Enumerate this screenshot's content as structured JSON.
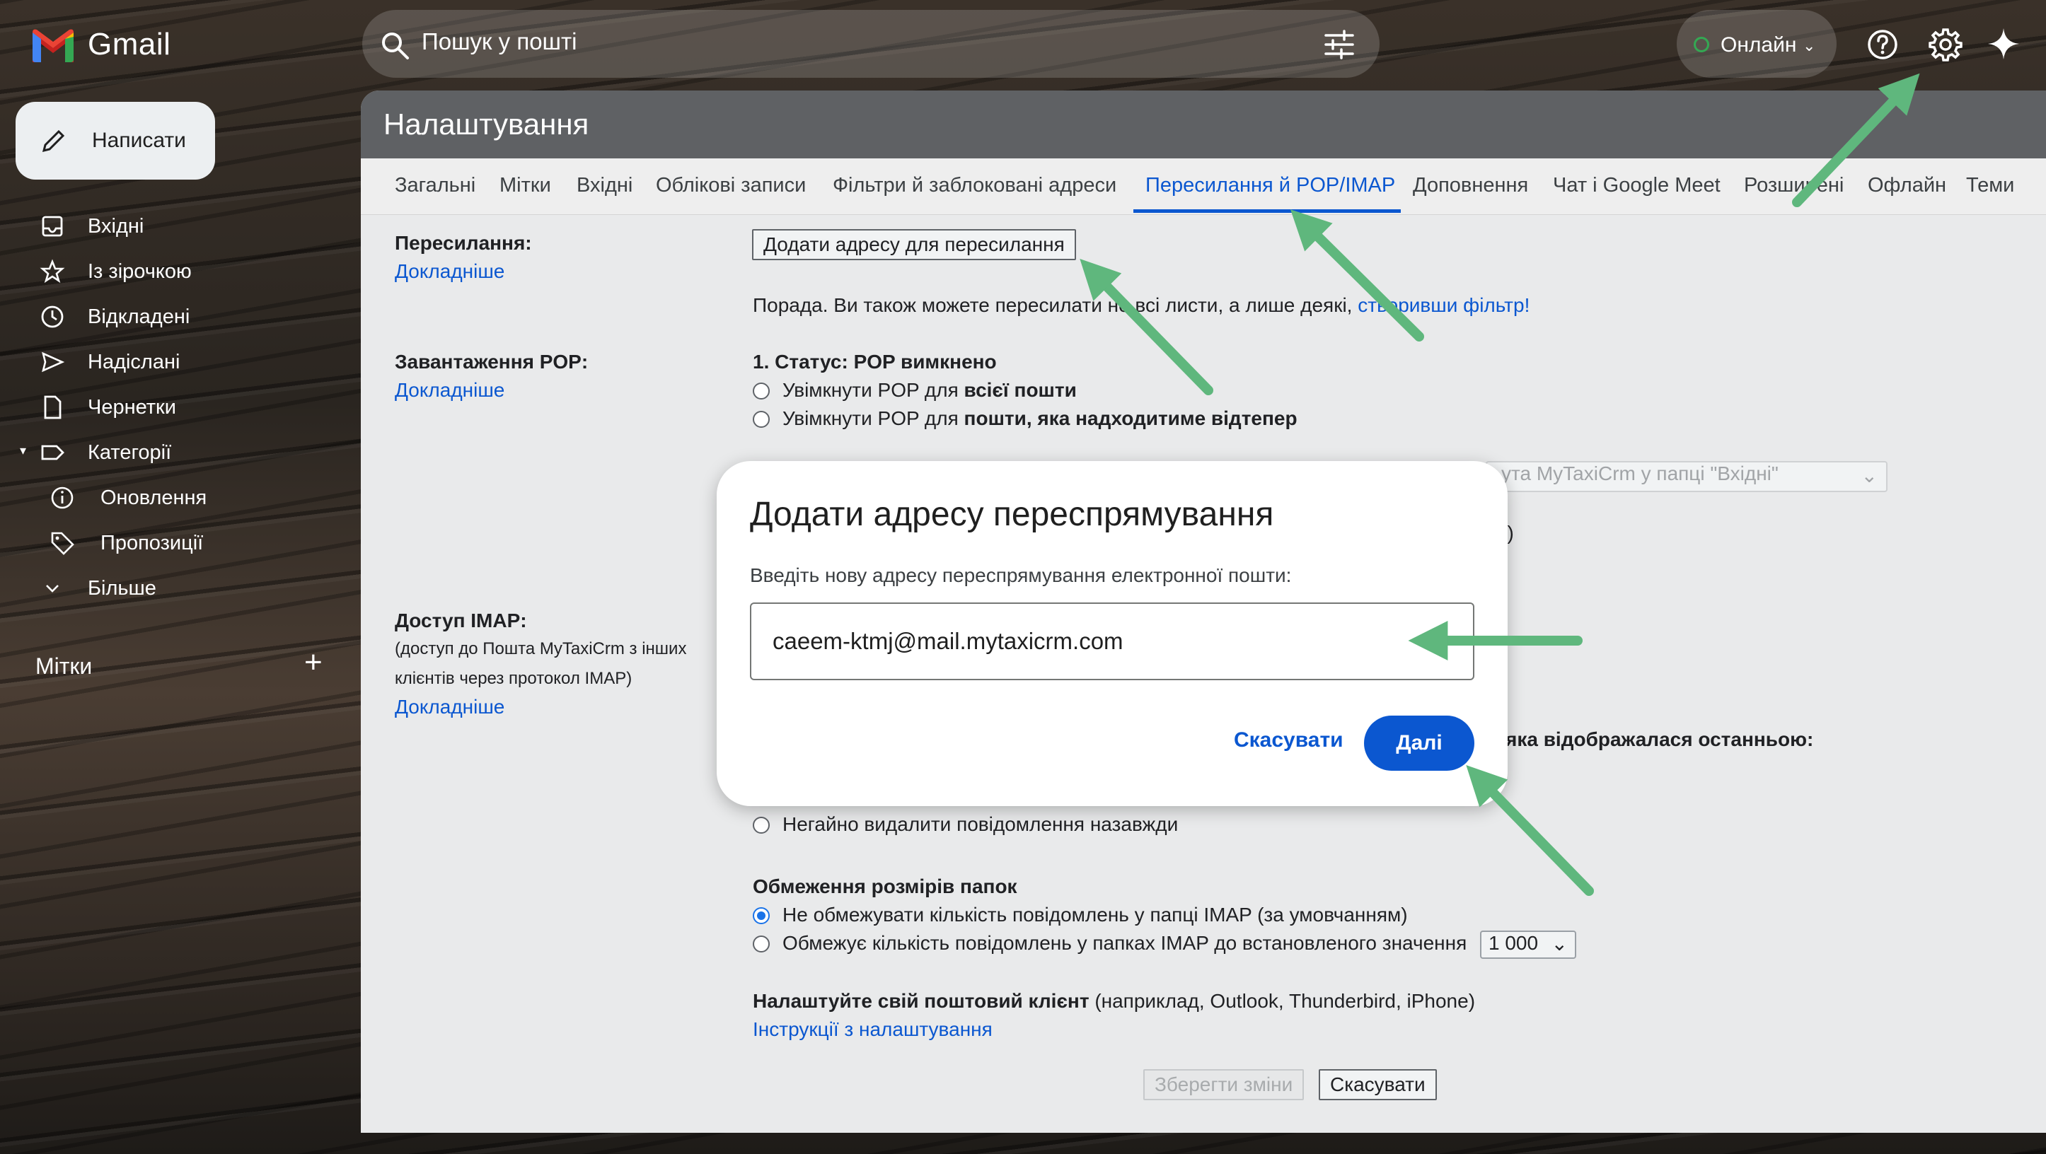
{
  "app": {
    "logo_text": "Gmail"
  },
  "search": {
    "placeholder": "Пошук у пошті"
  },
  "status": {
    "label": "Онлайн"
  },
  "compose": {
    "label": "Написати"
  },
  "sidebar": {
    "items": [
      {
        "label": "Вхідні"
      },
      {
        "label": "Із зірочкою"
      },
      {
        "label": "Відкладені"
      },
      {
        "label": "Надіслані"
      },
      {
        "label": "Чернетки"
      },
      {
        "label": "Категорії"
      },
      {
        "label": "Оновлення"
      },
      {
        "label": "Пропозиції"
      },
      {
        "label": "Більше"
      }
    ],
    "labels_heading": "Мітки",
    "labels_add": "+"
  },
  "settings": {
    "title": "Налаштування",
    "tabs": [
      {
        "label": "Загальні"
      },
      {
        "label": "Мітки"
      },
      {
        "label": "Вхідні"
      },
      {
        "label": "Облікові записи"
      },
      {
        "label": "Фільтри й заблоковані адреси"
      },
      {
        "label": "Пересилання й POP/IMAP",
        "active": true
      },
      {
        "label": "Доповнення"
      },
      {
        "label": "Чат і Google Meet"
      },
      {
        "label": "Розширені"
      },
      {
        "label": "Офлайн"
      },
      {
        "label": "Теми"
      }
    ],
    "forwarding": {
      "label": "Пересилання:",
      "learn_more": "Докладніше",
      "add_button": "Додати адресу для пересилання",
      "tip_prefix": "Порада. Ви також можете пересилати не всі листи, а лише деякі,",
      "tip_link": "створивши фільтр!"
    },
    "pop": {
      "label": "Завантаження POP:",
      "learn_more": "Докладніше",
      "status": "1. Статус: POP вимкнено",
      "option1_prefix": "Увімкнути POP для ",
      "option1_bold": "всієї пошти",
      "option2_prefix": "Увімкнути POP для ",
      "option2_bold": "пошти, яка надходитиме відтепер",
      "select_faded": "ута MyTaxiCrm у папці \"Вхідні\"",
      "partial_text": "il)"
    },
    "imap": {
      "label": "Доступ IMAP:",
      "desc_line1": "(доступ до Пошта MyTaxiCrm з інших",
      "desc_line2": "клієнтів через протокол IMAP)",
      "learn_more": "Докладніше",
      "partial_heading": "яка відображалася останньою:",
      "delete_option": "Негайно видалити повідомлення назавжди",
      "folder_heading": "Обмеження розмірів папок",
      "folder_opt1": "Не обмежувати кількість повідомлень у папці IMAP (за умовчанням)",
      "folder_opt2": "Обмежує кількість повідомлень у папках IMAP до встановленого значення",
      "folder_limit": "1 000",
      "client_bold": "Налаштуйте свій поштовий клієнт",
      "client_rest": " (наприклад, Outlook, Thunderbird, iPhone)",
      "client_link": "Інструкції з налаштування"
    },
    "footer": {
      "save": "Зберегти зміни",
      "cancel": "Скасувати"
    }
  },
  "dialog": {
    "title": "Додати адресу переспрямування",
    "prompt": "Введіть нову адресу переспрямування електронної пошти:",
    "input_value": "caeem-ktmj@mail.mytaxicrm.com",
    "cancel": "Скасувати",
    "next": "Далі"
  },
  "colors": {
    "accent": "#0b57d0",
    "arrow": "#5fb77d"
  }
}
